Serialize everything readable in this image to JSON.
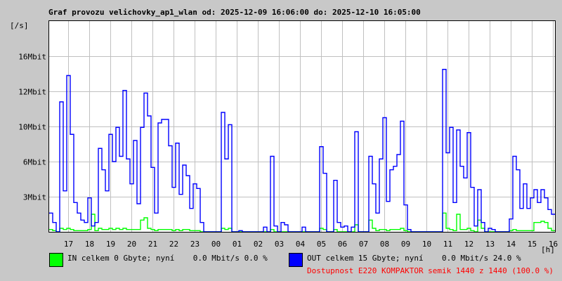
{
  "chart_data": {
    "type": "line",
    "title": "Graf provozu velichovky_ap1_wlan od: 2025-12-09 16:06:00 do: 2025-12-10 16:05:00",
    "ylabel": "[/s]",
    "xlabel": "[h]",
    "x_start": "16:06",
    "x_step_minutes": 10,
    "x_ticks": [
      "17",
      "18",
      "19",
      "20",
      "21",
      "22",
      "23",
      "00",
      "01",
      "02",
      "03",
      "04",
      "05",
      "06",
      "07",
      "08",
      "09",
      "10",
      "11",
      "12",
      "13",
      "14",
      "15",
      "16"
    ],
    "y_ticks": [
      {
        "label": "3Mbit",
        "value": 3
      },
      {
        "label": "6Mbit",
        "value": 6
      },
      {
        "label": "10Mbit",
        "value": 10
      },
      {
        "label": "12Mbit",
        "value": 12
      },
      {
        "label": "16Mbit",
        "value": 16
      }
    ],
    "ylim": [
      0,
      20
    ],
    "grid": true,
    "series": [
      {
        "name": "OUT",
        "color": "#0000ff",
        "values": [
          1.6,
          0.8,
          0,
          11.4,
          3.5,
          13.8,
          9.1,
          2.5,
          1.6,
          1.0,
          0.8,
          2.9,
          0.5,
          0.8,
          7.5,
          5.3,
          3.5,
          9.1,
          6,
          9.9,
          6.6,
          12.1,
          6.3,
          4.1,
          8.4,
          2.4,
          9.9,
          11.9,
          10.6,
          5.5,
          1.6,
          10.2,
          10.4,
          10.4,
          7.8,
          3.8,
          8.1,
          3.2,
          5.7,
          4.8,
          2,
          4.1,
          3.7,
          0.8,
          0,
          0,
          0,
          0,
          0,
          10.8,
          6.3,
          10.1,
          0,
          0,
          0.1,
          0,
          0,
          0,
          0,
          0,
          0,
          0.4,
          0,
          6.6,
          0.5,
          0,
          0.8,
          0.6,
          0,
          0,
          0,
          0,
          0.4,
          0,
          0,
          0,
          0,
          7.7,
          5,
          0,
          0,
          4.4,
          0.8,
          0.4,
          0.5,
          0,
          0.4,
          9.4,
          0,
          0,
          0,
          6.6,
          4.1,
          1.6,
          6.3,
          10.5,
          2.6,
          5.3,
          5.6,
          6.8,
          10.3,
          2.3,
          0.2,
          0,
          0,
          0,
          0,
          0,
          0,
          0,
          0,
          0,
          14.5,
          7,
          9.9,
          2.5,
          9.6,
          5.6,
          4.6,
          9.3,
          3.8,
          0.5,
          3.6,
          0.8,
          0,
          0.3,
          0.2,
          0,
          0,
          0,
          0,
          1.1,
          6.6,
          5.3,
          2,
          4.1,
          2,
          2.9,
          3.6,
          2.5,
          3.6,
          2.9,
          1.9,
          1.5
        ]
      },
      {
        "name": "IN",
        "color": "#00ff00",
        "values": [
          0.2,
          0.1,
          0,
          0.3,
          0.2,
          0.3,
          0.2,
          0.1,
          0.1,
          0.1,
          0.1,
          0.2,
          1.5,
          0.1,
          0.3,
          0.2,
          0.2,
          0.3,
          0.2,
          0.3,
          0.2,
          0.3,
          0.2,
          0.2,
          0.2,
          0.2,
          1.0,
          1.2,
          0.3,
          0.2,
          0.1,
          0.2,
          0.2,
          0.2,
          0.2,
          0.1,
          0.2,
          0.1,
          0.2,
          0.2,
          0.1,
          0.1,
          0.1,
          0,
          0,
          0,
          0,
          0,
          0,
          0.3,
          0.2,
          0.3,
          0,
          0,
          0,
          0,
          0,
          0,
          0,
          0,
          0,
          0,
          0,
          0.2,
          0,
          0,
          0,
          0,
          0,
          0,
          0,
          0,
          0,
          0,
          0,
          0,
          0,
          0.3,
          0.2,
          0,
          0,
          0.2,
          0,
          0,
          0,
          0,
          0,
          0.6,
          0,
          0,
          0,
          1.0,
          0.3,
          0.1,
          0.2,
          0.2,
          0.1,
          0.2,
          0.2,
          0.2,
          0.3,
          0.1,
          0,
          0,
          0,
          0,
          0,
          0,
          0,
          0,
          0,
          0,
          1.6,
          0.3,
          0.2,
          0.1,
          1.5,
          0.2,
          0.2,
          0.3,
          0.1,
          0,
          1.0,
          0.3,
          0,
          0,
          0,
          0,
          0,
          0,
          0,
          0.1,
          0.2,
          0.1,
          0.1,
          0.1,
          0.1,
          0.1,
          0.8,
          0.8,
          0.9,
          0.8,
          0.3,
          0.1
        ]
      }
    ]
  },
  "legend": {
    "in_text": "IN celkem 0 Gbyte; nyní    0.0 Mbit/s 0.0 %",
    "out_text": "OUT celkem 15 Gbyte; nyní    0.0 Mbit/s 24.0 %",
    "availability_text": "Dostupnost E220 KOMPAKTOR semik 1440 z 1440 (100.0 %)",
    "in_color": "#00ff00",
    "out_color": "#0000ff",
    "availability_color": "#ff0000"
  }
}
